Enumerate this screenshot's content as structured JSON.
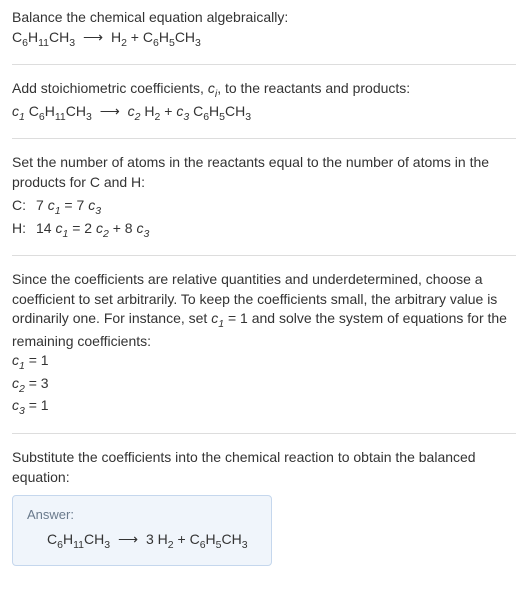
{
  "intro": {
    "line1": "Balance the chemical equation algebraically:"
  },
  "eq1": {
    "r1a": "C",
    "r1as": "6",
    "r1b": "H",
    "r1bs": "11",
    "r1c": "CH",
    "r1cs": "3",
    "arrow": "⟶",
    "p1a": "H",
    "p1as": "2",
    "plus": " + ",
    "p2a": "C",
    "p2as": "6",
    "p2b": "H",
    "p2bs": "5",
    "p2c": "CH",
    "p2cs": "3"
  },
  "step2": {
    "text_a": "Add stoichiometric coefficients, ",
    "ci": "c",
    "ci_sub": "i",
    "text_b": ", to the reactants and products:"
  },
  "eq2": {
    "c1": "c",
    "c1s": "1",
    "c2": "c",
    "c2s": "2",
    "c3": "c",
    "c3s": "3"
  },
  "step3": {
    "text": "Set the number of atoms in the reactants equal to the number of atoms in the products for C and H:"
  },
  "atoms": {
    "c_label": "C: ",
    "c_lhs_a": "7 ",
    "c_lhs_c": "c",
    "c_lhs_s": "1",
    "c_eq": " = ",
    "c_rhs_a": "7 ",
    "c_rhs_c": "c",
    "c_rhs_s": "3",
    "h_label": "H: ",
    "h_lhs_a": "14 ",
    "h_lhs_c": "c",
    "h_lhs_s": "1",
    "h_eq": " = ",
    "h_rhs1_a": "2 ",
    "h_rhs1_c": "c",
    "h_rhs1_s": "2",
    "h_plus": " + ",
    "h_rhs2_a": "8 ",
    "h_rhs2_c": "c",
    "h_rhs2_s": "3"
  },
  "step4": {
    "text_a": "Since the coefficients are relative quantities and underdetermined, choose a coefficient to set arbitrarily. To keep the coefficients small, the arbitrary value is ordinarily one. For instance, set ",
    "c": "c",
    "cs": "1",
    "text_b": " = 1 and solve the system of equations for the remaining coefficients:"
  },
  "sol": {
    "l1_c": "c",
    "l1_s": "1",
    "l1_v": " = 1",
    "l2_c": "c",
    "l2_s": "2",
    "l2_v": " = 3",
    "l3_c": "c",
    "l3_s": "3",
    "l3_v": " = 1"
  },
  "step5": {
    "text": "Substitute the coefficients into the chemical reaction to obtain the balanced equation:"
  },
  "answer": {
    "label": "Answer:",
    "coef2": "3 "
  }
}
